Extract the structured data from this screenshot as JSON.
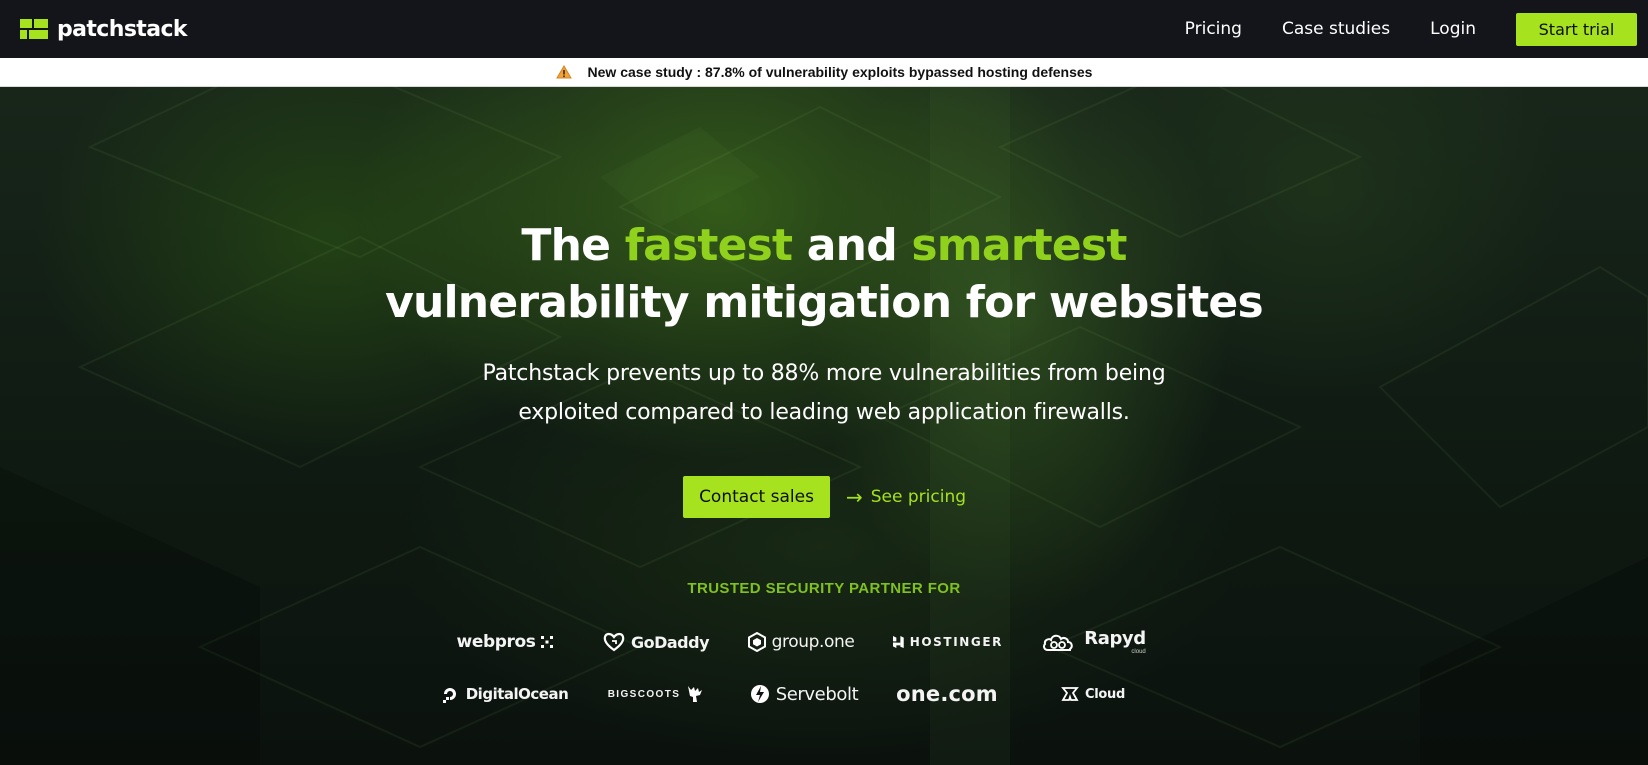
{
  "nav": {
    "brand": "patchstack",
    "links": [
      "Pricing",
      "Case studies",
      "Login"
    ],
    "cta": "Start trial",
    "brand_color": "#a6e21d",
    "background": "#13151a"
  },
  "announcement": {
    "icon": "warning-icon",
    "text": "New case study : 87.8% of vulnerability exploits bypassed hosting defenses"
  },
  "hero": {
    "headline_line1": [
      "The ",
      "fastest",
      " and ",
      "smartest"
    ],
    "headline_line2": "vulnerability mitigation for websites",
    "subtext_line1": "Patchstack prevents up to 88% more vulnerabilities from being",
    "subtext_line2": "exploited compared to leading web application firewalls.",
    "primary_cta": "Contact sales",
    "secondary_cta": "See pricing",
    "secondary_icon": "arrow-right-icon",
    "accent_color": "#8fd11c"
  },
  "partners": {
    "heading": "TRUSTED SECURITY PARTNER FOR",
    "row1": [
      "webpros",
      "GoDaddy",
      "group.one",
      "HOSTINGER",
      "Rapyd"
    ],
    "row1_sublabel": "cloud",
    "row2": [
      "DigitalOcean",
      "BIGSCOOTS",
      "Servebolt",
      "one.com",
      "Cloud"
    ]
  }
}
